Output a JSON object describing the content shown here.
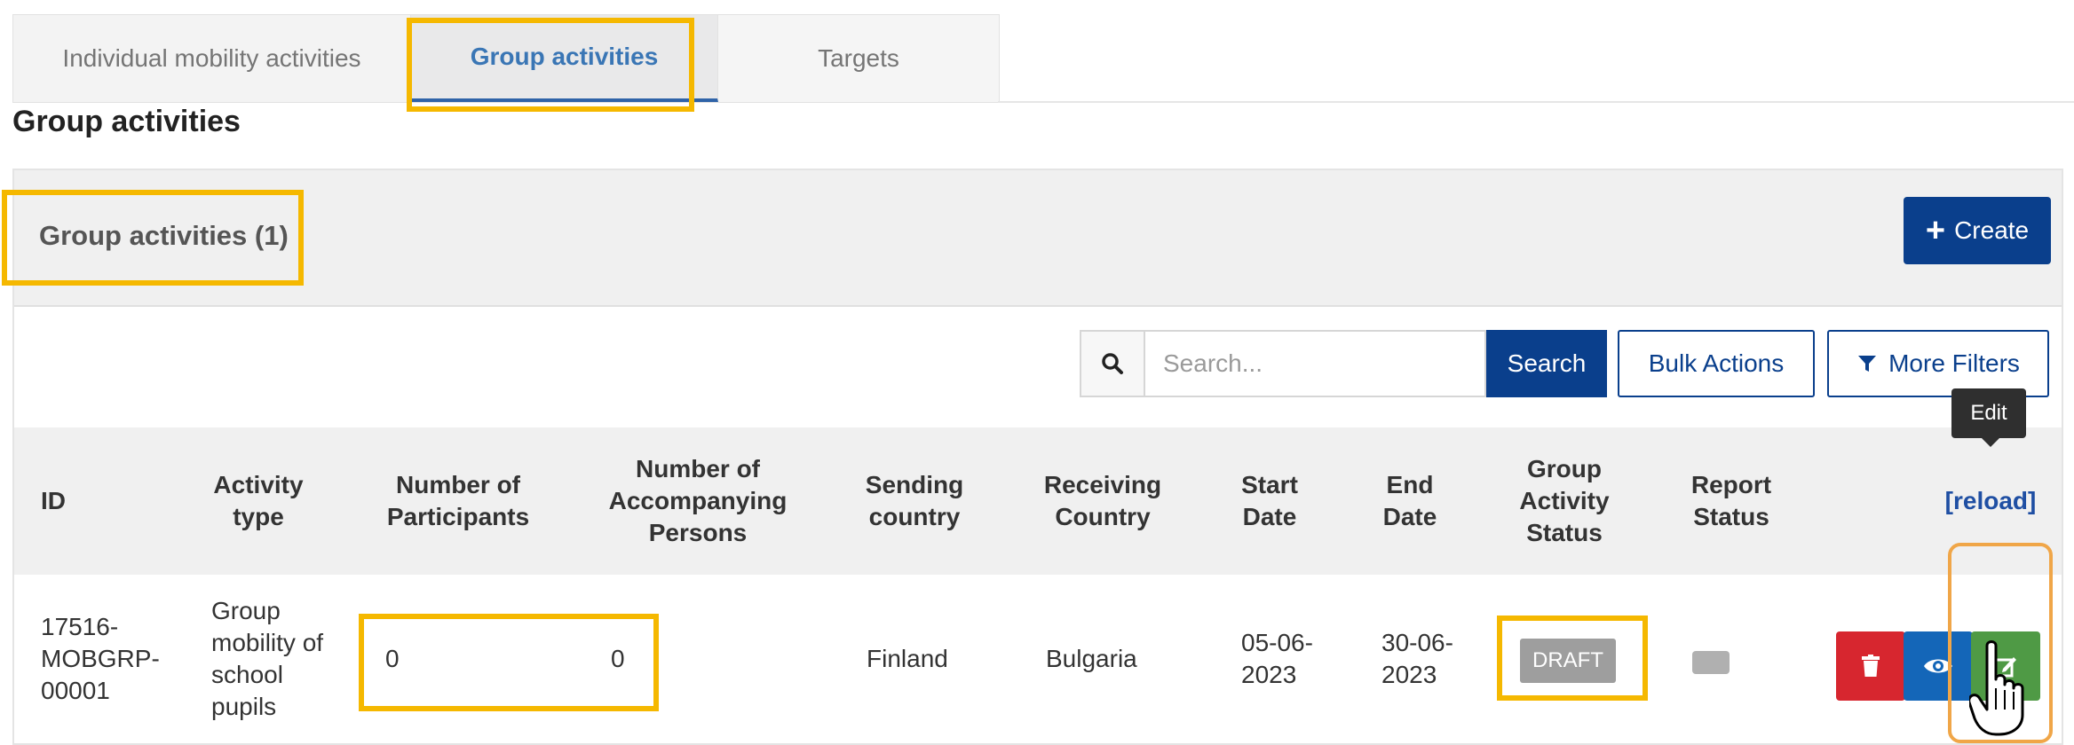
{
  "tabs": [
    {
      "label": "Individual mobility activities"
    },
    {
      "label": "Group activities"
    },
    {
      "label": "Targets"
    }
  ],
  "page_title": "Group activities",
  "panel": {
    "title": "Group activities (1)",
    "create_label": "Create"
  },
  "toolbar": {
    "search_placeholder": "Search...",
    "search_button": "Search",
    "bulk_actions": "Bulk Actions",
    "more_filters": "More Filters"
  },
  "table": {
    "headers": {
      "id": "ID",
      "activity_type": "Activity type",
      "participants": "Number of Participants",
      "accompanying": "Number of Accompanying Persons",
      "sending": "Sending country",
      "receiving": "Receiving Country",
      "start": "Start Date",
      "end": "End Date",
      "status": "Group Activity Status",
      "report": "Report Status",
      "reload": "[reload]"
    },
    "rows": [
      {
        "id": "17516-MOBGRP-00001",
        "activity_type": "Group mobility of school pupils",
        "participants": "0",
        "accompanying": "0",
        "sending": "Finland",
        "receiving": "Bulgaria",
        "start": "05-06-2023",
        "end": "30-06-2023",
        "status": "DRAFT"
      }
    ]
  },
  "tooltip": "Edit",
  "colors": {
    "primary": "#0a3f8c",
    "highlight": "#f5b800",
    "delete": "#d7262f",
    "view": "#1466b8",
    "edit": "#4f9a45"
  }
}
